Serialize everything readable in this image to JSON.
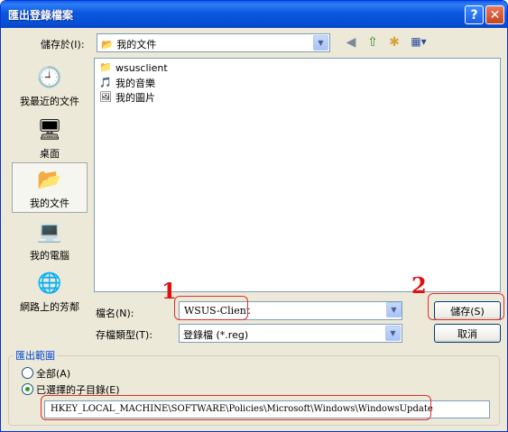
{
  "window": {
    "title": "匯出登錄檔案",
    "help_glyph": "?",
    "close_glyph": "✕"
  },
  "toolbar": {
    "save_in_label": "儲存於(I):",
    "location": "我的文件",
    "location_icon": "folder-documents-icon",
    "tools": [
      {
        "name": "back-icon",
        "glyph": "◀"
      },
      {
        "name": "up-folder-icon",
        "glyph": "⇧"
      },
      {
        "name": "new-folder-icon",
        "glyph": "✱"
      },
      {
        "name": "view-menu-icon",
        "glyph": "▦▾"
      }
    ]
  },
  "places": [
    {
      "label": "我最近的文件",
      "icon": "recent-documents-icon",
      "glyph": "🕘",
      "selected": false
    },
    {
      "label": "桌面",
      "icon": "desktop-icon",
      "glyph": "🖥",
      "selected": false
    },
    {
      "label": "我的文件",
      "icon": "my-documents-icon",
      "glyph": "📂",
      "selected": true
    },
    {
      "label": "我的電腦",
      "icon": "my-computer-icon",
      "glyph": "💻",
      "selected": false
    },
    {
      "label": "網路上的芳鄰",
      "icon": "network-places-icon",
      "glyph": "🌐",
      "selected": false
    }
  ],
  "files": [
    {
      "name": "wsusclient",
      "icon": "folder-icon",
      "glyph": "📁"
    },
    {
      "name": "我的音樂",
      "icon": "music-folder-icon",
      "glyph": "🎵"
    },
    {
      "name": "我的圖片",
      "icon": "pictures-folder-icon",
      "glyph": "🖼"
    }
  ],
  "filename": {
    "label": "檔名(N):",
    "value": "WSUS-Client"
  },
  "filetype": {
    "label": "存檔類型(T):",
    "value": "登錄檔 (*.reg)"
  },
  "buttons": {
    "save": "儲存(S)",
    "cancel": "取消"
  },
  "annotations": {
    "one": "1",
    "two": "2"
  },
  "export_range": {
    "title": "匯出範圍",
    "all_label": "全部(A)",
    "selected_branch_label": "已選擇的子目錄(E)",
    "selected": "branch",
    "branch_path": "HKEY_LOCAL_MACHINE\\SOFTWARE\\Policies\\Microsoft\\Windows\\WindowsUpdate"
  }
}
